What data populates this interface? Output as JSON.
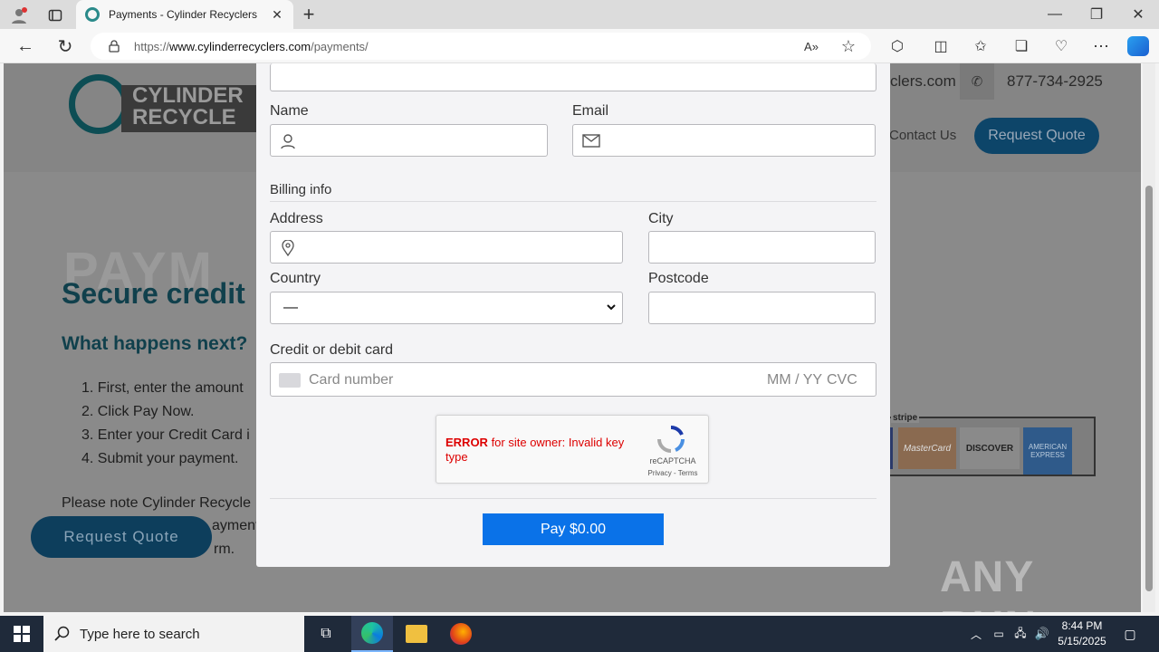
{
  "browser": {
    "tab_title": "Payments - Cylinder Recyclers",
    "url_prefix": "https://",
    "url_host": "www.cylinderrecyclers.com",
    "url_path": "/payments/"
  },
  "site": {
    "logo_text_1": "CYLINDER",
    "logo_text_2": "RECYCLE",
    "domain_fragment": "clers.com",
    "phone": "877-734-2925",
    "nav_contact": "Contact Us",
    "request_quote": "Request Quote",
    "heading_ghost": "PAYM",
    "heading": "Secure credit",
    "subheading": "What happens next?",
    "steps": [
      "1. First, enter the amount",
      "2. Click Pay Now.",
      "3. Enter your Credit Card i",
      "4. Submit your payment."
    ],
    "note_1": "Please note Cylinder Recycle",
    "note_2": "ayment",
    "note_3": "rm.",
    "floating_quote": "Request Quote",
    "stripe_label": "stripe",
    "card_logos": [
      "MasterCard",
      "DISCOVER",
      "AMERICAN EXPRESS"
    ]
  },
  "form": {
    "name_label": "Name",
    "email_label": "Email",
    "billing_label": "Billing info",
    "address_label": "Address",
    "city_label": "City",
    "country_label": "Country",
    "country_value": "—",
    "postcode_label": "Postcode",
    "card_label": "Credit or debit card",
    "card_placeholder": "Card number",
    "card_expiry": "MM / YY",
    "card_cvc": "CVC",
    "recaptcha_error_strong": "ERROR",
    "recaptcha_error_rest": " for site owner: Invalid key type",
    "recaptcha_brand": "reCAPTCHA",
    "recaptcha_links": "Privacy - Terms",
    "pay_button": "Pay $0.00"
  },
  "watermark": "ANY RUN",
  "taskbar": {
    "search_placeholder": "Type here to search",
    "time": "8:44 PM",
    "date": "5/15/2025"
  },
  "colors": {
    "pay_button": "#0a72e8",
    "brand_teal": "#0d5b6b",
    "quote_button": "#0f5d8c"
  }
}
